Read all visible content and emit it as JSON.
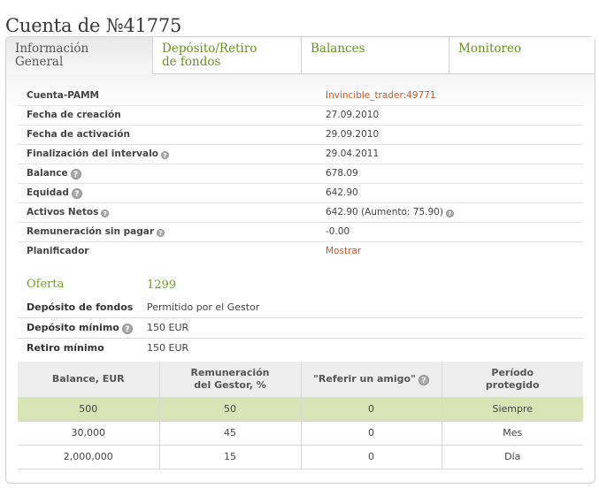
{
  "page": {
    "title": "Cuenta de №41775"
  },
  "tabs": [
    {
      "line1": "Información",
      "line2": "General"
    },
    {
      "line1": "Depósito/Retiro",
      "line2": "de fondos"
    },
    {
      "line1": "Balances",
      "line2": ""
    },
    {
      "line1": "Monitoreo",
      "line2": ""
    }
  ],
  "info": {
    "pamm_label": "Cuenta-PAMM",
    "pamm_value": "Invincible_trader:49771",
    "created_label": "Fecha de creación",
    "created_value": "27.09.2010",
    "activated_label": "Fecha de activación",
    "activated_value": "29.09.2010",
    "interval_label": "Finalización del intervalo",
    "interval_value": "29.04.2011",
    "balance_label": "Balance",
    "balance_value": "678.09",
    "equity_label": "Equidad",
    "equity_value": "642.90",
    "net_label": "Activos Netos",
    "net_value": "642.90 (Aumento: 75.90)",
    "unpaid_label": "Remuneración sin pagar",
    "unpaid_value": "-0.00",
    "scheduler_label": "Planificador",
    "scheduler_value": "Mostrar"
  },
  "offer": {
    "label": "Oferta",
    "number": "1299",
    "deposit_label": "Depósito de fondos",
    "deposit_value": "Permitido por el Gestor",
    "min_deposit_label": "Depósito mínimo",
    "min_deposit_value": "150 EUR",
    "min_withdraw_label": "Retiro mínimo",
    "min_withdraw_value": "150 EUR"
  },
  "levels": {
    "headers": {
      "balance": "Balance, EUR",
      "remun_line1": "Remuneración",
      "remun_line2": "del Gestor, %",
      "refer": "\"Referir un amigo\"",
      "period_line1": "Período",
      "period_line2": "protegido"
    },
    "rows": [
      {
        "balance": "500",
        "remun": "50",
        "refer": "0",
        "period": "Siempre"
      },
      {
        "balance": "30,000",
        "remun": "45",
        "refer": "0",
        "period": "Mes"
      },
      {
        "balance": "2,000,000",
        "remun": "15",
        "refer": "0",
        "period": "Día"
      }
    ]
  },
  "icons": {
    "help": "question-mark-icon",
    "help_glyph": "?"
  },
  "colors": {
    "accent_green": "#6a8f1f",
    "link_orange": "#d0582a",
    "highlight_row": "#d8e4b6"
  }
}
